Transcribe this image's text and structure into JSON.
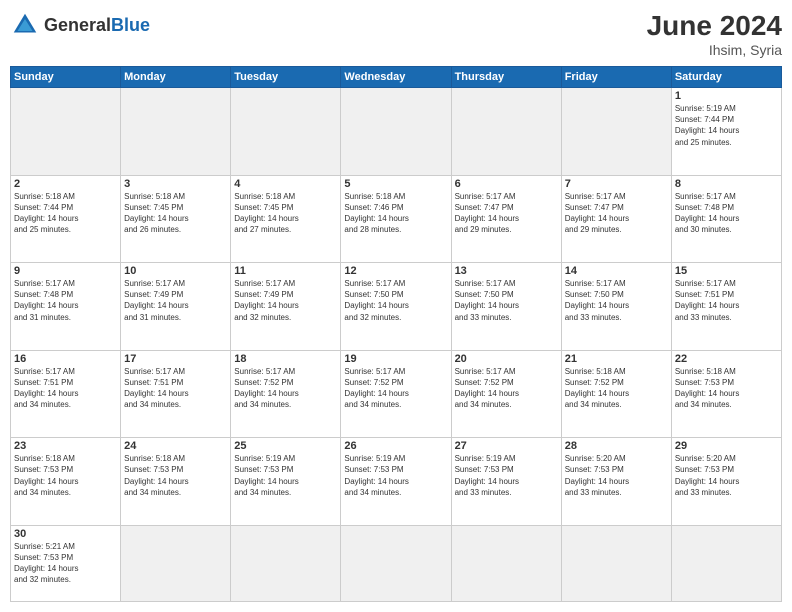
{
  "header": {
    "logo_general": "General",
    "logo_blue": "Blue",
    "month_title": "June 2024",
    "location": "Ihsim, Syria"
  },
  "weekdays": [
    "Sunday",
    "Monday",
    "Tuesday",
    "Wednesday",
    "Thursday",
    "Friday",
    "Saturday"
  ],
  "days": [
    {
      "num": "",
      "empty": true,
      "info": ""
    },
    {
      "num": "",
      "empty": true,
      "info": ""
    },
    {
      "num": "",
      "empty": true,
      "info": ""
    },
    {
      "num": "",
      "empty": true,
      "info": ""
    },
    {
      "num": "",
      "empty": true,
      "info": ""
    },
    {
      "num": "",
      "empty": true,
      "info": ""
    },
    {
      "num": "1",
      "empty": false,
      "info": "Sunrise: 5:19 AM\nSunset: 7:44 PM\nDaylight: 14 hours\nand 25 minutes."
    },
    {
      "num": "2",
      "empty": false,
      "info": "Sunrise: 5:18 AM\nSunset: 7:44 PM\nDaylight: 14 hours\nand 25 minutes."
    },
    {
      "num": "3",
      "empty": false,
      "info": "Sunrise: 5:18 AM\nSunset: 7:45 PM\nDaylight: 14 hours\nand 26 minutes."
    },
    {
      "num": "4",
      "empty": false,
      "info": "Sunrise: 5:18 AM\nSunset: 7:45 PM\nDaylight: 14 hours\nand 27 minutes."
    },
    {
      "num": "5",
      "empty": false,
      "info": "Sunrise: 5:18 AM\nSunset: 7:46 PM\nDaylight: 14 hours\nand 28 minutes."
    },
    {
      "num": "6",
      "empty": false,
      "info": "Sunrise: 5:17 AM\nSunset: 7:47 PM\nDaylight: 14 hours\nand 29 minutes."
    },
    {
      "num": "7",
      "empty": false,
      "info": "Sunrise: 5:17 AM\nSunset: 7:47 PM\nDaylight: 14 hours\nand 29 minutes."
    },
    {
      "num": "8",
      "empty": false,
      "info": "Sunrise: 5:17 AM\nSunset: 7:48 PM\nDaylight: 14 hours\nand 30 minutes."
    },
    {
      "num": "9",
      "empty": false,
      "info": "Sunrise: 5:17 AM\nSunset: 7:48 PM\nDaylight: 14 hours\nand 31 minutes."
    },
    {
      "num": "10",
      "empty": false,
      "info": "Sunrise: 5:17 AM\nSunset: 7:49 PM\nDaylight: 14 hours\nand 31 minutes."
    },
    {
      "num": "11",
      "empty": false,
      "info": "Sunrise: 5:17 AM\nSunset: 7:49 PM\nDaylight: 14 hours\nand 32 minutes."
    },
    {
      "num": "12",
      "empty": false,
      "info": "Sunrise: 5:17 AM\nSunset: 7:50 PM\nDaylight: 14 hours\nand 32 minutes."
    },
    {
      "num": "13",
      "empty": false,
      "info": "Sunrise: 5:17 AM\nSunset: 7:50 PM\nDaylight: 14 hours\nand 33 minutes."
    },
    {
      "num": "14",
      "empty": false,
      "info": "Sunrise: 5:17 AM\nSunset: 7:50 PM\nDaylight: 14 hours\nand 33 minutes."
    },
    {
      "num": "15",
      "empty": false,
      "info": "Sunrise: 5:17 AM\nSunset: 7:51 PM\nDaylight: 14 hours\nand 33 minutes."
    },
    {
      "num": "16",
      "empty": false,
      "info": "Sunrise: 5:17 AM\nSunset: 7:51 PM\nDaylight: 14 hours\nand 34 minutes."
    },
    {
      "num": "17",
      "empty": false,
      "info": "Sunrise: 5:17 AM\nSunset: 7:51 PM\nDaylight: 14 hours\nand 34 minutes."
    },
    {
      "num": "18",
      "empty": false,
      "info": "Sunrise: 5:17 AM\nSunset: 7:52 PM\nDaylight: 14 hours\nand 34 minutes."
    },
    {
      "num": "19",
      "empty": false,
      "info": "Sunrise: 5:17 AM\nSunset: 7:52 PM\nDaylight: 14 hours\nand 34 minutes."
    },
    {
      "num": "20",
      "empty": false,
      "info": "Sunrise: 5:17 AM\nSunset: 7:52 PM\nDaylight: 14 hours\nand 34 minutes."
    },
    {
      "num": "21",
      "empty": false,
      "info": "Sunrise: 5:18 AM\nSunset: 7:52 PM\nDaylight: 14 hours\nand 34 minutes."
    },
    {
      "num": "22",
      "empty": false,
      "info": "Sunrise: 5:18 AM\nSunset: 7:53 PM\nDaylight: 14 hours\nand 34 minutes."
    },
    {
      "num": "23",
      "empty": false,
      "info": "Sunrise: 5:18 AM\nSunset: 7:53 PM\nDaylight: 14 hours\nand 34 minutes."
    },
    {
      "num": "24",
      "empty": false,
      "info": "Sunrise: 5:18 AM\nSunset: 7:53 PM\nDaylight: 14 hours\nand 34 minutes."
    },
    {
      "num": "25",
      "empty": false,
      "info": "Sunrise: 5:19 AM\nSunset: 7:53 PM\nDaylight: 14 hours\nand 34 minutes."
    },
    {
      "num": "26",
      "empty": false,
      "info": "Sunrise: 5:19 AM\nSunset: 7:53 PM\nDaylight: 14 hours\nand 34 minutes."
    },
    {
      "num": "27",
      "empty": false,
      "info": "Sunrise: 5:19 AM\nSunset: 7:53 PM\nDaylight: 14 hours\nand 33 minutes."
    },
    {
      "num": "28",
      "empty": false,
      "info": "Sunrise: 5:20 AM\nSunset: 7:53 PM\nDaylight: 14 hours\nand 33 minutes."
    },
    {
      "num": "29",
      "empty": false,
      "info": "Sunrise: 5:20 AM\nSunset: 7:53 PM\nDaylight: 14 hours\nand 33 minutes."
    },
    {
      "num": "30",
      "empty": false,
      "info": "Sunrise: 5:21 AM\nSunset: 7:53 PM\nDaylight: 14 hours\nand 32 minutes."
    },
    {
      "num": "",
      "empty": true,
      "info": ""
    },
    {
      "num": "",
      "empty": true,
      "info": ""
    },
    {
      "num": "",
      "empty": true,
      "info": ""
    },
    {
      "num": "",
      "empty": true,
      "info": ""
    },
    {
      "num": "",
      "empty": true,
      "info": ""
    },
    {
      "num": "",
      "empty": true,
      "info": ""
    }
  ]
}
